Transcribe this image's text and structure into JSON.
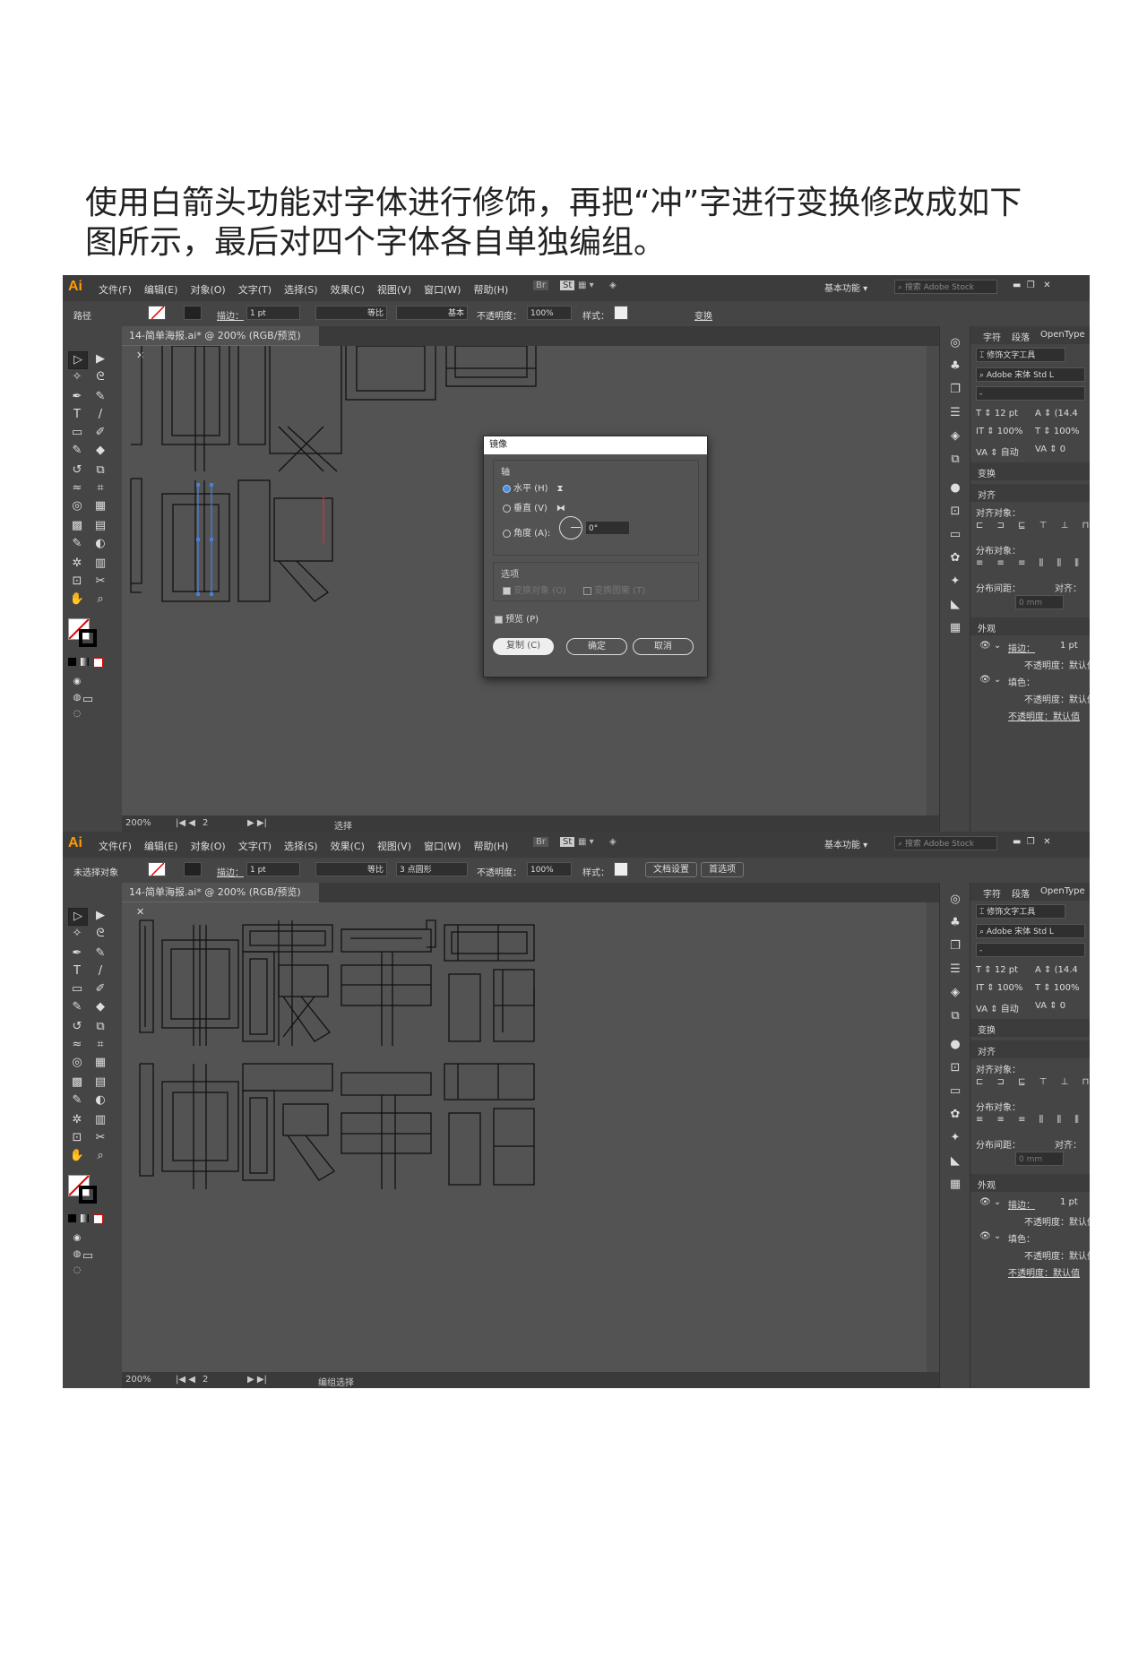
{
  "caption": {
    "line1": "使用白箭头功能对字体进行修饰，再把“冲”字进行变换修改成如下",
    "line2": "图所示，最后对四个字体各自单独编组。"
  },
  "menus": [
    "文件(F)",
    "编辑(E)",
    "对象(O)",
    "文字(T)",
    "选择(S)",
    "效果(C)",
    "视图(V)",
    "窗口(W)",
    "帮助(H)"
  ],
  "app": {
    "logo": "Ai",
    "workspace": "基本功能",
    "search_placeholder": "搜索 Adobe Stock",
    "br": "Br",
    "st": "St"
  },
  "top_screenshot": {
    "control": {
      "selection_label": "路径",
      "stroke_label": "描边：",
      "stroke_weight": "1 pt",
      "profile": "等比",
      "brush": "基本",
      "opacity_label": "不透明度：",
      "opacity": "100%",
      "style_label": "样式：",
      "transform": "变换"
    },
    "doc_tab": "14-简单海报.ai* @ 200% (RGB/预览)",
    "zoom": "200%",
    "page": "2",
    "status_tool": "选择",
    "dialog": {
      "title": "镜像",
      "axis_group": "轴",
      "horizontal": "水平 (H)",
      "vertical": "垂直 (V)",
      "angle": "角度 (A):",
      "angle_value": "0°",
      "options_group": "选项",
      "transform_objects": "变换对象 (O)",
      "transform_patterns": "变换图案 (T)",
      "preview": "预览 (P)",
      "copy_button": "复制 (C)",
      "ok_button": "确定",
      "cancel_button": "取消"
    }
  },
  "bottom_screenshot": {
    "control": {
      "selection_label": "未选择对象",
      "stroke_label": "描边：",
      "stroke_weight": "1 pt",
      "profile": "等比",
      "brush": "3 点圆形",
      "opacity_label": "不透明度：",
      "opacity": "100%",
      "style_label": "样式：",
      "doc_setup": "文档设置",
      "preferences": "首选项"
    },
    "doc_tab": "14-简单海报.ai* @ 200% (RGB/预览)",
    "zoom": "200%",
    "page": "2",
    "status_tool": "编组选择"
  },
  "panel": {
    "tabs": [
      "字符",
      "段落",
      "OpenType"
    ],
    "touch_type": "修饰文字工具",
    "font": "Adobe 宋体 Std L",
    "font_style": "-",
    "size": "12 pt",
    "leading": "(14.4",
    "vscale": "100%",
    "hscale": "100%",
    "kerning": "自动",
    "tracking": "0",
    "transform": "变换",
    "align": "对齐",
    "align_to": "对齐对象：",
    "distribute": "分布对象：",
    "spacing": "分布间距：",
    "align_to_short": "对齐：",
    "spacing_value": "0 mm",
    "appearance": "外观",
    "stroke": "描边：",
    "stroke_value": "1 pt",
    "opacity": "不透明度：默认值",
    "fill": "填色："
  }
}
